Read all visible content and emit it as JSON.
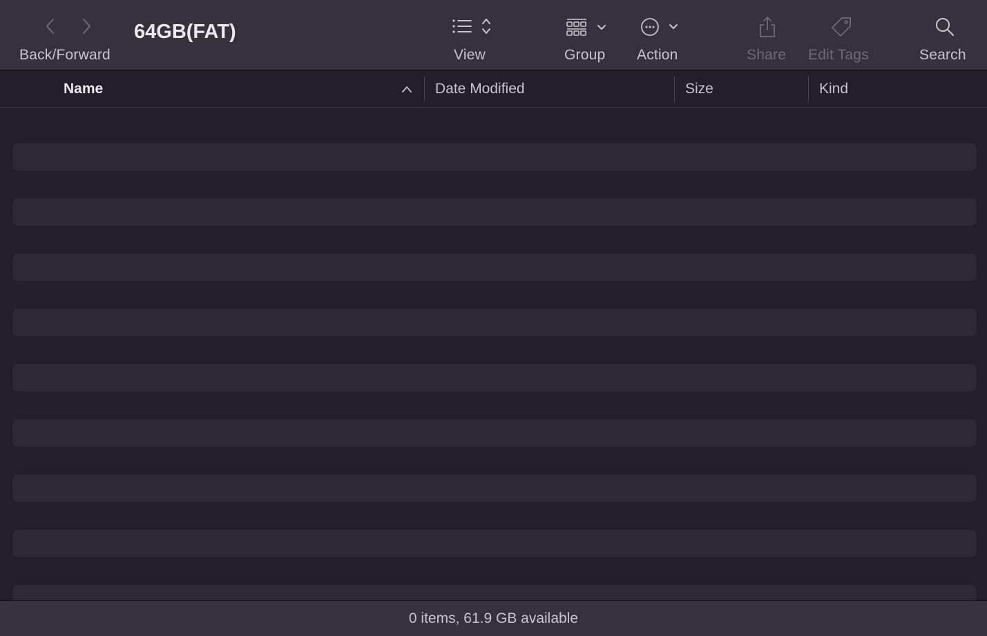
{
  "window": {
    "title": "64GB(FAT)"
  },
  "toolbar": {
    "nav_label": "Back/Forward",
    "view_label": "View",
    "group_label": "Group",
    "action_label": "Action",
    "share_label": "Share",
    "edit_tags_label": "Edit Tags",
    "search_label": "Search",
    "icons": {
      "back": "chevron-left-icon",
      "forward": "chevron-right-icon",
      "view": "list-view-icon",
      "group": "grid-group-icon",
      "action": "ellipsis-circle-icon",
      "share": "share-icon",
      "edit_tags": "tag-icon",
      "search": "search-icon"
    }
  },
  "columns": {
    "name": "Name",
    "date_modified": "Date Modified",
    "size": "Size",
    "kind": "Kind",
    "sorted_by": "Name",
    "sort_direction": "ascending"
  },
  "list": {
    "items": []
  },
  "status": {
    "text": "0 items, 61.9 GB available"
  },
  "colors": {
    "toolbar_bg": "#35313d",
    "list_bg": "#221e2b",
    "stripe_bg": "#2d2936",
    "text_primary": "#ece9f0",
    "text_secondary": "#c9c5cf",
    "text_disabled": "#6f6b78"
  }
}
